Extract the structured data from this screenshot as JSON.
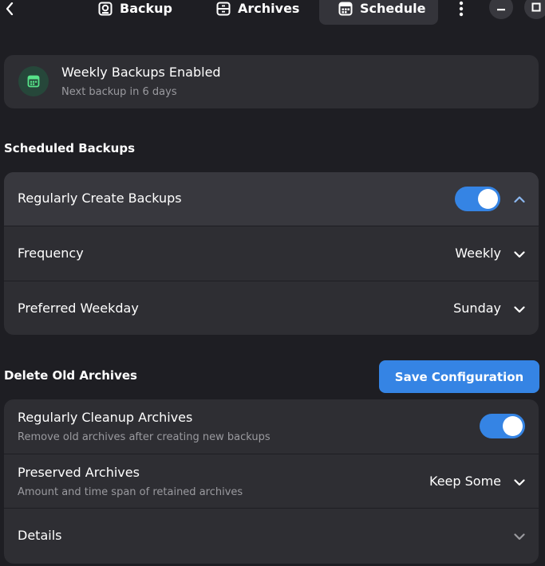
{
  "header": {
    "tabs": [
      {
        "label": "Backup",
        "icon": "backup-icon"
      },
      {
        "label": "Archives",
        "icon": "archives-icon"
      },
      {
        "label": "Schedule",
        "icon": "calendar-icon",
        "active": true
      }
    ]
  },
  "status": {
    "title": "Weekly Backups Enabled",
    "subtitle": "Next backup in 6 days",
    "icon": "calendar-icon",
    "icon_bg": "#26473a",
    "icon_color": "#57e389"
  },
  "scheduled": {
    "section_title": "Scheduled Backups",
    "regularly": {
      "label": "Regularly Create Backups",
      "enabled": true
    },
    "frequency": {
      "label": "Frequency",
      "value": "Weekly"
    },
    "weekday": {
      "label": "Preferred Weekday",
      "value": "Sunday"
    }
  },
  "delete": {
    "section_title": "Delete Old Archives",
    "save_label": "Save Configuration",
    "cleanup": {
      "label": "Regularly Cleanup Archives",
      "subtitle": "Remove old archives after creating new backups",
      "enabled": true
    },
    "preserved": {
      "label": "Preserved Archives",
      "subtitle": "Amount and time span of retained archives",
      "value": "Keep Some"
    },
    "details": {
      "label": "Details"
    }
  },
  "colors": {
    "accent": "#3584e4",
    "card": "#2e2e33",
    "background": "#1e1e23"
  }
}
